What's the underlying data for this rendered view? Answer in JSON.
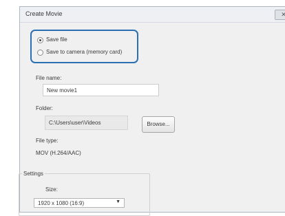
{
  "dialog": {
    "title": "Create Movie",
    "close_label": "✕"
  },
  "save_options": [
    {
      "label": "Save file",
      "checked": true
    },
    {
      "label": "Save to camera (memory card)",
      "checked": false
    }
  ],
  "file_name": {
    "label": "File name:",
    "value": "New movie1"
  },
  "folder": {
    "label": "Folder:",
    "value": "C:\\Users\\user\\Videos",
    "browse_label": "Browse..."
  },
  "file_type": {
    "label": "File type:",
    "value": "MOV (H.264/AAC)"
  },
  "settings": {
    "legend": "Settings",
    "size_label": "Size:",
    "size_value": "1920 x 1080 (16:9)"
  }
}
